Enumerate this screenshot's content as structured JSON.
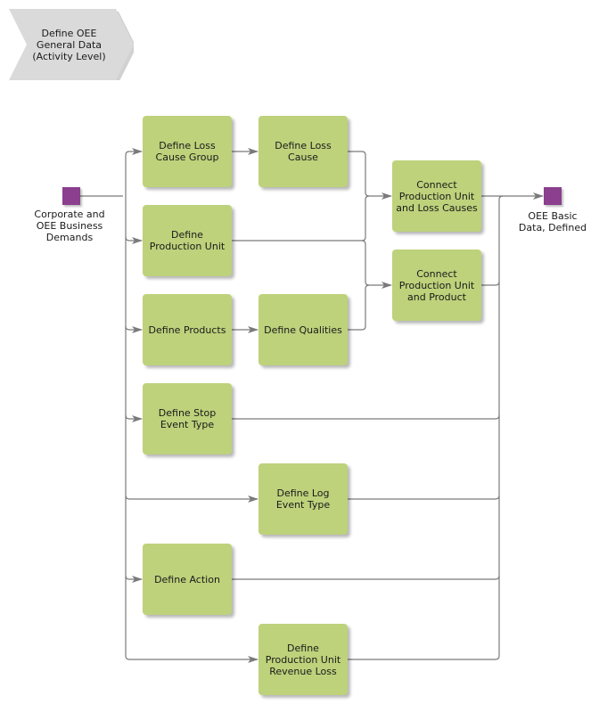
{
  "diagram": {
    "header": {
      "label": "Define OEE\nGeneral Data\n(Activity Level)",
      "fill": "#dadada"
    },
    "start_event": {
      "label": "Corporate and\nOEE Business\nDemands",
      "color": "#8b3f8e"
    },
    "end_event": {
      "label": "OEE Basic\nData, Defined",
      "color": "#8b3f8e"
    },
    "functions": [
      {
        "id": "loss-cause-group",
        "label": "Define Loss\nCause Group"
      },
      {
        "id": "loss-cause",
        "label": "Define Loss\nCause"
      },
      {
        "id": "production-unit",
        "label": "Define\nProduction Unit"
      },
      {
        "id": "products",
        "label": "Define Products"
      },
      {
        "id": "qualities",
        "label": "Define Qualities"
      },
      {
        "id": "connect-loss-causes",
        "label": "Connect\nProduction Unit\nand Loss Causes"
      },
      {
        "id": "connect-product",
        "label": "Connect\nProduction Unit\nand Product"
      },
      {
        "id": "stop-event-type",
        "label": "Define Stop\nEvent Type"
      },
      {
        "id": "log-event-type",
        "label": "Define Log\nEvent Type"
      },
      {
        "id": "action",
        "label": "Define Action"
      },
      {
        "id": "revenue-loss",
        "label": "Define\nProduction Unit\nRevenue Loss"
      }
    ],
    "function_color": "#bdd27b",
    "connector_color": "#7a7a7a"
  }
}
